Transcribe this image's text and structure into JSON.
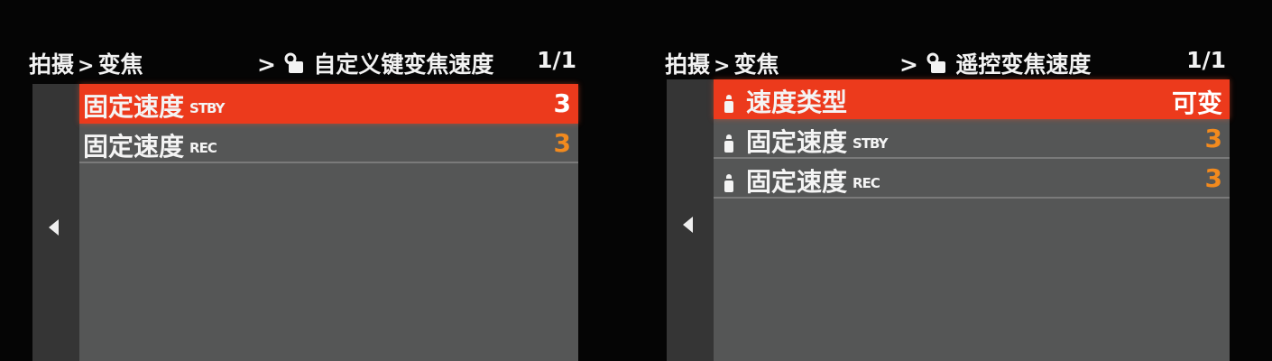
{
  "left_screen": {
    "breadcrumb": [
      "拍摄",
      "变焦"
    ],
    "submenu_title": "自定义键变焦速度",
    "page_indicator": "1/1",
    "rows": [
      {
        "label": "固定速度",
        "tag": "STBY",
        "value": "3",
        "selected": true
      },
      {
        "label": "固定速度",
        "tag": "REC",
        "value": "3",
        "selected": false
      }
    ]
  },
  "right_screen": {
    "breadcrumb": [
      "拍摄",
      "变焦"
    ],
    "submenu_title": "遥控变焦速度",
    "page_indicator": "1/1",
    "rows": [
      {
        "label": "速度类型",
        "tag": "",
        "value": "可变",
        "selected": true
      },
      {
        "label": "固定速度",
        "tag": "STBY",
        "value": "3",
        "selected": false
      },
      {
        "label": "固定速度",
        "tag": "REC",
        "value": "3",
        "selected": false
      }
    ]
  },
  "colors": {
    "selected_row": "#ec3a1c",
    "value_text": "#f28a1e",
    "menu_background": "#555656",
    "side_rail": "#353535"
  },
  "icons": [
    "lock-icon",
    "left-arrow-icon",
    "bulb-icon"
  ]
}
